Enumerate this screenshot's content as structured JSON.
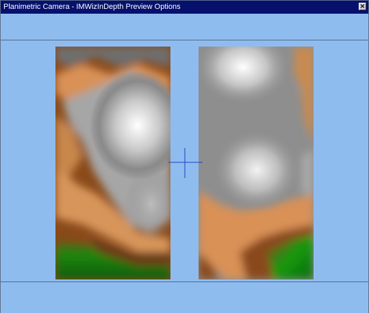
{
  "window": {
    "title": "Planimetric Camera - IMWizInDepth Preview Options",
    "close_glyph": "×"
  },
  "preview": {
    "left_panel": "heightmap",
    "right_panel": "heightmap",
    "crosshair_color": "#1b3fbf"
  },
  "colors": {
    "window_bg": "#8fbcef",
    "titlebar_bg": "#06116e"
  }
}
